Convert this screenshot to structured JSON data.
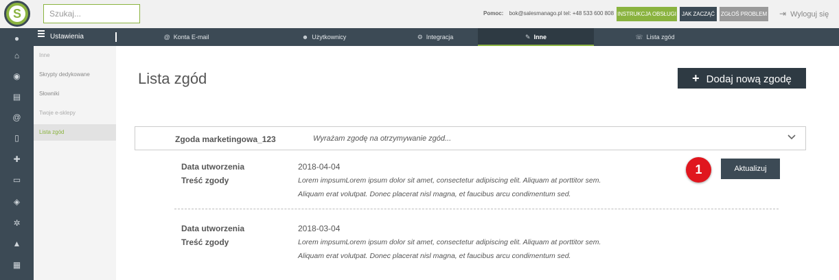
{
  "app": {
    "logo_letter": "S",
    "brand_color": "#8ab33f",
    "dark_color": "#3c4a55",
    "alert_color": "#e0161e"
  },
  "topbar": {
    "search_placeholder": "Szukaj...",
    "help_label": "Pomoc:",
    "help_contact": "bok@salesmanago.pl tel: +48 533 600 808",
    "btn_instructions": "INSTRUKCJA OBSŁUGI",
    "btn_start": "JAK ZACZĄĆ",
    "btn_report": "ZGŁOŚ PROBLEM",
    "logout_label": "Wyloguj się",
    "logout_icon": "logout-icon"
  },
  "iconbar": {
    "items": [
      {
        "name": "user-icon",
        "glyph": "●"
      },
      {
        "name": "home-icon",
        "glyph": "⌂"
      },
      {
        "name": "eye-icon",
        "glyph": "◉"
      },
      {
        "name": "contact-card-icon",
        "glyph": "▤"
      },
      {
        "name": "at-icon",
        "glyph": "@"
      },
      {
        "name": "mobile-icon",
        "glyph": "▯"
      },
      {
        "name": "add-user-icon",
        "glyph": "✚"
      },
      {
        "name": "laptop-icon",
        "glyph": "▭"
      },
      {
        "name": "users-icon",
        "glyph": "◈"
      },
      {
        "name": "cogs-icon",
        "glyph": "✲"
      },
      {
        "name": "chart-icon",
        "glyph": "▲"
      },
      {
        "name": "calendar-icon",
        "glyph": "▦"
      }
    ]
  },
  "nav": {
    "title": "Ustawienia",
    "tabs": [
      {
        "label": "Konta E-mail",
        "icon": "@"
      },
      {
        "label": "Użytkownicy",
        "icon": "☻"
      },
      {
        "label": "Integracja",
        "icon": "⚙"
      },
      {
        "label": "Inne",
        "icon": "✎"
      },
      {
        "label": "Lista zgód",
        "icon": "☏"
      }
    ]
  },
  "subnav": {
    "items": [
      {
        "label": "Inne"
      },
      {
        "label": "Skrypty dedykowane"
      },
      {
        "label": "Słowniki"
      },
      {
        "label": "Twoje e-sklepy"
      },
      {
        "label": "Lista zgód"
      }
    ]
  },
  "main": {
    "title": "Lista zgód",
    "add_button": "Dodaj nową zgodę",
    "consent": {
      "name": "Zgoda marketingowa_123",
      "preview": "Wyrażam zgodę na otrzymywanie zgód..."
    },
    "entries": [
      {
        "created_label": "Data utworzenia",
        "created_value": "2018-04-04",
        "content_label": "Treść zgody",
        "content_line1": "Lorem impsumLorem ipsum dolor sit amet, consectetur adipiscing elit. Aliquam at porttitor sem.",
        "content_line2": "Aliquam erat volutpat. Donec placerat nisl magna, et faucibus arcu condimentum sed."
      },
      {
        "created_label": "Data utworzenia",
        "created_value": "2018-03-04",
        "content_label": "Treść zgody",
        "content_line1": "Lorem impsumLorem ipsum dolor sit amet, consectetur adipiscing elit. Aliquam at porttitor sem.",
        "content_line2": "Aliquam erat volutpat. Donec placerat nisl magna, et faucibus arcu condimentum sed."
      }
    ],
    "update_button": "Aktualizuj",
    "callout_number": "1"
  }
}
